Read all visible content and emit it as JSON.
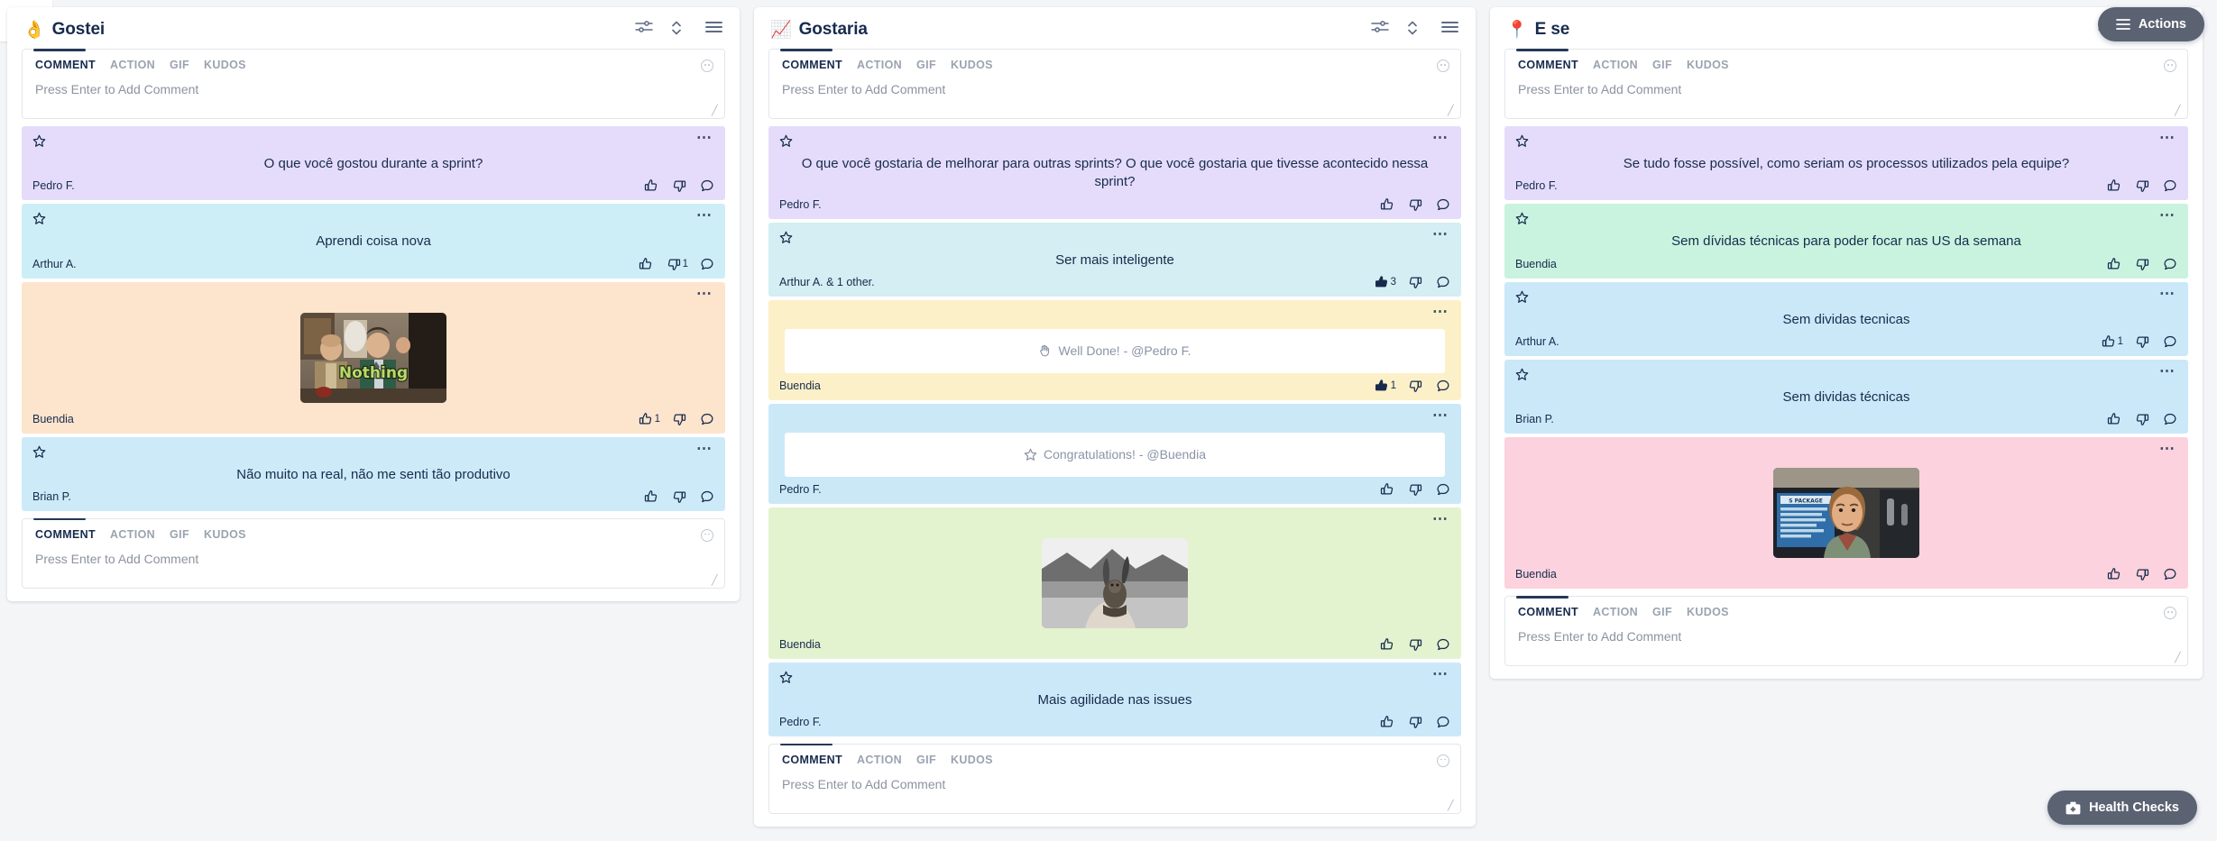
{
  "app": {
    "sidebar_toggle_icon": "chevrons-right-icon",
    "background": "#f4f5f7"
  },
  "actions_button": {
    "label": "Actions",
    "icon": "hamburger-icon",
    "color": "#5b6272"
  },
  "health_checks_button": {
    "label": "Health Checks",
    "icon": "medkit-icon",
    "color": "#5b6272"
  },
  "composer": {
    "tabs": [
      "COMMENT",
      "ACTION",
      "GIF",
      "KUDOS"
    ],
    "active_tab": "COMMENT",
    "placeholder": "Press Enter to Add Comment",
    "emoji_icon": "emoji-smiley-icon"
  },
  "column_tools": [
    "filter-settings-icon",
    "sort-updown-icon",
    "list-view-icon"
  ],
  "columns": [
    {
      "emoji": "👌",
      "title": "Gostei",
      "cards": [
        {
          "type": "text",
          "text": "O que você gostou durante a sprint?",
          "author": "Pedro F.",
          "color": "#e5dcfb",
          "starred": false,
          "likes": "",
          "dislikes": "",
          "like_active": false,
          "dislike_active": false
        },
        {
          "type": "text",
          "text": "Aprendi coisa nova",
          "author": "Arthur A.",
          "color": "#cdeef6",
          "starred": false,
          "likes": "",
          "dislikes": "1",
          "like_active": false,
          "dislike_active": false
        },
        {
          "type": "gif",
          "gif_caption": "Nothing",
          "gif_scene": "seinfeld-nothing",
          "author": "Buendia",
          "color": "#fde4cd",
          "starred": false,
          "likes": "1",
          "dislikes": "",
          "like_active": false,
          "dislike_active": false
        },
        {
          "type": "text",
          "text": "Não muito na real, não me senti tão produtivo",
          "author": "Brian P.",
          "color": "#cdeaf9",
          "starred": false,
          "likes": "",
          "dislikes": "",
          "like_active": false,
          "dislike_active": false
        }
      ]
    },
    {
      "emoji": "📈",
      "title": "Gostaria",
      "cards": [
        {
          "type": "text",
          "text": "O que você gostaria de melhorar para outras sprints? O que você gostaria que tivesse acontecido nessa sprint?",
          "author": "Pedro F.",
          "color": "#e5dcfb",
          "starred": false,
          "likes": "",
          "dislikes": "",
          "like_active": false,
          "dislike_active": false
        },
        {
          "type": "text",
          "text": "Ser mais inteligente",
          "author": "Arthur A. & 1 other.",
          "color": "#d4eef3",
          "starred": false,
          "likes": "3",
          "dislikes": "",
          "like_active": true,
          "dislike_active": false
        },
        {
          "type": "kudos",
          "kudos_icon": "clap-hand-icon",
          "kudos_text": "Well Done! - @Pedro F.",
          "author": "Buendia",
          "color": "#fcf0c8",
          "starred": false,
          "likes": "1",
          "dislikes": "",
          "like_active": true,
          "dislike_active": false
        },
        {
          "type": "kudos",
          "kudos_icon": "star-outline-icon",
          "kudos_text": "Congratulations! - @Buendia",
          "author": "Pedro F.",
          "color": "#cbe8f7",
          "starred": false,
          "likes": "",
          "dislikes": "",
          "like_active": false,
          "dislike_active": false
        },
        {
          "type": "gif",
          "gif_caption": "",
          "gif_scene": "turtle-hand",
          "author": "Buendia",
          "color": "#e3f3cf",
          "starred": false,
          "likes": "",
          "dislikes": "",
          "like_active": false,
          "dislike_active": false
        },
        {
          "type": "text",
          "text": "Mais agilidade nas issues",
          "author": "Pedro F.",
          "color": "#cbe8f9",
          "starred": false,
          "likes": "",
          "dislikes": "",
          "like_active": false,
          "dislike_active": false
        }
      ]
    },
    {
      "emoji": "📍",
      "title": "E se",
      "cards": [
        {
          "type": "text",
          "text": "Se tudo fosse possível, como seriam os processos utilizados pela equipe?",
          "author": "Pedro F.",
          "color": "#e5dcfb",
          "starred": false,
          "likes": "",
          "dislikes": "",
          "like_active": false,
          "dislike_active": false
        },
        {
          "type": "text",
          "text": "Sem dívidas técnicas para poder focar nas US da semana",
          "author": "Buendia",
          "color": "#c9f3df",
          "starred": false,
          "likes": "",
          "dislikes": "",
          "like_active": false,
          "dislike_active": false
        },
        {
          "type": "text",
          "text": "Sem dividas tecnicas",
          "author": "Arthur A.",
          "color": "#cbe8f9",
          "starred": false,
          "likes": "1",
          "dislikes": "",
          "like_active": false,
          "dislike_active": false
        },
        {
          "type": "text",
          "text": "Sem dividas técnicas",
          "author": "Brian P.",
          "color": "#cbe8f9",
          "starred": false,
          "likes": "",
          "dislikes": "",
          "like_active": false,
          "dislike_active": false
        },
        {
          "type": "gif",
          "gif_caption": "",
          "gif_scene": "total-recall",
          "author": "Buendia",
          "color": "#fbd2dd",
          "starred": false,
          "likes": "",
          "dislikes": "",
          "like_active": false,
          "dislike_active": false
        }
      ]
    }
  ]
}
